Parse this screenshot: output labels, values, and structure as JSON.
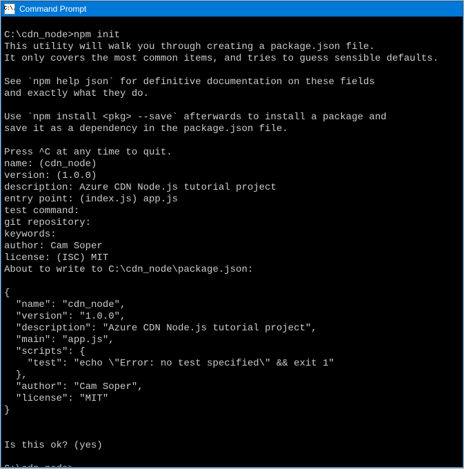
{
  "titlebar": {
    "icon_label": "C:\\.",
    "title": "Command Prompt"
  },
  "terminal": {
    "lines": [
      "",
      "C:\\cdn_node>npm init",
      "This utility will walk you through creating a package.json file.",
      "It only covers the most common items, and tries to guess sensible defaults.",
      "",
      "See `npm help json` for definitive documentation on these fields",
      "and exactly what they do.",
      "",
      "Use `npm install <pkg> --save` afterwards to install a package and",
      "save it as a dependency in the package.json file.",
      "",
      "Press ^C at any time to quit.",
      "name: (cdn_node)",
      "version: (1.0.0)",
      "description: Azure CDN Node.js tutorial project",
      "entry point: (index.js) app.js",
      "test command:",
      "git repository:",
      "keywords:",
      "author: Cam Soper",
      "license: (ISC) MIT",
      "About to write to C:\\cdn_node\\package.json:",
      "",
      "{",
      "  \"name\": \"cdn_node\",",
      "  \"version\": \"1.0.0\",",
      "  \"description\": \"Azure CDN Node.js tutorial project\",",
      "  \"main\": \"app.js\",",
      "  \"scripts\": {",
      "    \"test\": \"echo \\\"Error: no test specified\\\" && exit 1\"",
      "  },",
      "  \"author\": \"Cam Soper\",",
      "  \"license\": \"MIT\"",
      "}",
      "",
      "",
      "Is this ok? (yes)",
      "",
      "C:\\cdn_node>"
    ]
  }
}
